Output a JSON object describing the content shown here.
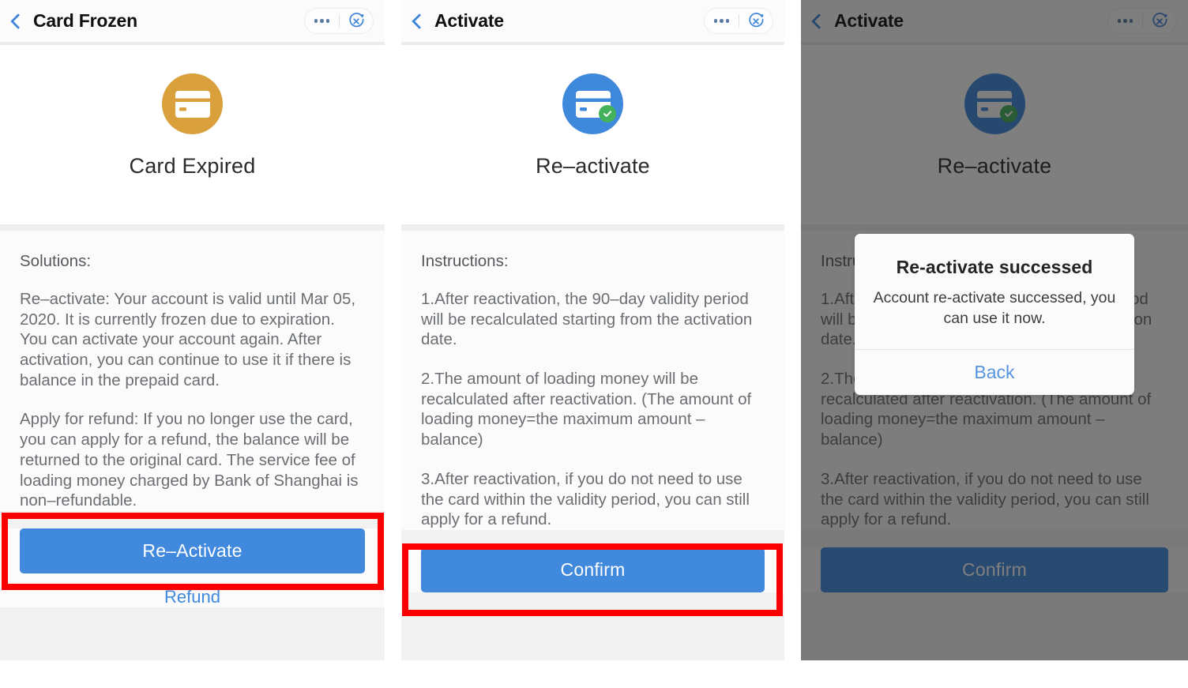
{
  "panels": [
    {
      "id": "card-frozen",
      "nav": {
        "title": "Card Frozen",
        "back_icon": "chevron-left-icon",
        "more_icon": "more-dots-icon",
        "close_icon": "close-circle-icon"
      },
      "hero": {
        "icon": "credit-card-icon",
        "icon_color": "#d9a03c",
        "title": "Card Expired"
      },
      "body": {
        "lead": "Solutions:",
        "paragraphs": [
          "Re–activate: Your account is valid until Mar 05, 2020. It is currently frozen due to expiration. You can activate your account again. After activation, you can continue to use it if there is balance in the prepaid card.",
          "Apply for refund: If you no longer use the card, you can apply for a refund, the balance will be returned to the original card. The service fee of loading money charged by Bank of Shanghai is non–refundable."
        ]
      },
      "primary_button": "Re–Activate",
      "secondary_link": "Refund",
      "highlighted": true
    },
    {
      "id": "activate",
      "nav": {
        "title": "Activate",
        "back_icon": "chevron-left-icon",
        "more_icon": "more-dots-icon",
        "close_icon": "close-circle-icon"
      },
      "hero": {
        "icon": "credit-card-check-icon",
        "icon_color": "#3f89dc",
        "badge_color": "#44b25b",
        "title": "Re–activate"
      },
      "body": {
        "lead": "Instructions:",
        "paragraphs": [
          "1.After reactivation, the 90–day validity period will be recalculated starting from the activation date.",
          "2.The amount of loading money will be recalculated after reactivation. (The amount of loading money=the maximum amount – balance)",
          "3.After reactivation, if you do not need to use the card within the validity period, you can still apply for a refund."
        ]
      },
      "primary_button": "Confirm",
      "secondary_link": null,
      "highlighted": true
    },
    {
      "id": "activate-success",
      "nav": {
        "title": "Activate",
        "back_icon": "chevron-left-icon",
        "more_icon": "more-dots-icon",
        "close_icon": "close-circle-icon"
      },
      "hero": {
        "icon": "credit-card-check-icon",
        "icon_color": "#3f89dc",
        "badge_color": "#44b25b",
        "title": "Re–activate"
      },
      "body": {
        "lead": "Instructions:",
        "paragraphs": [
          "1.After reactivation, the 90–day validity period will be recalculated starting from the activation date.",
          "2.The amount of loading money will be recalculated after reactivation. (The amount of loading money=the maximum amount – balance)",
          "3.After reactivation, if you do not need to use the card within the validity period, you can still apply for a refund."
        ]
      },
      "primary_button": "Confirm",
      "secondary_link": null,
      "highlighted": false,
      "dimmed": true
    }
  ],
  "modal": {
    "title": "Re-activate successed",
    "message": "Account re-activate successed, you can use it now.",
    "action_label": "Back"
  },
  "colors": {
    "accent_blue": "#4089dd",
    "link_blue": "#5594e0",
    "warning_orange": "#d9a03c",
    "success_green": "#44b25b",
    "annotation_red": "#fa0000",
    "panel_bg": "#f2f2f2",
    "card_bg": "#fbfbfb"
  }
}
